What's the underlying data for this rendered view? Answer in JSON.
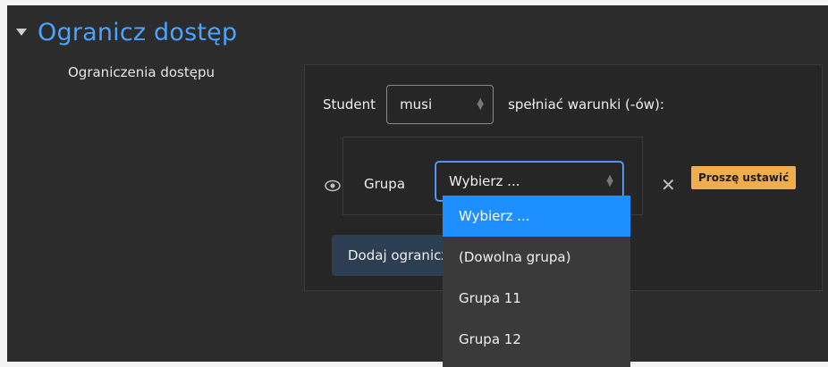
{
  "section": {
    "title": "Ogranicz dostęp"
  },
  "field": {
    "label": "Ograniczenia dostępu"
  },
  "student_row": {
    "prefix": "Student",
    "requirement_value": "musi",
    "suffix": "spełniać warunki (-ów):"
  },
  "condition": {
    "type_label": "Grupa",
    "selected_value": "Wybierz ...",
    "status_badge": "Proszę ustawić"
  },
  "add_button": {
    "label": "Dodaj ograniczenie..."
  },
  "dropdown": {
    "options": [
      "Wybierz ...",
      "(Dowolna grupa)",
      "Grupa 11",
      "Grupa 12"
    ]
  },
  "colors": {
    "accent_blue": "#4aa3ff",
    "selected_option": "#1e8fff",
    "badge_warning": "#f0ad4e"
  }
}
